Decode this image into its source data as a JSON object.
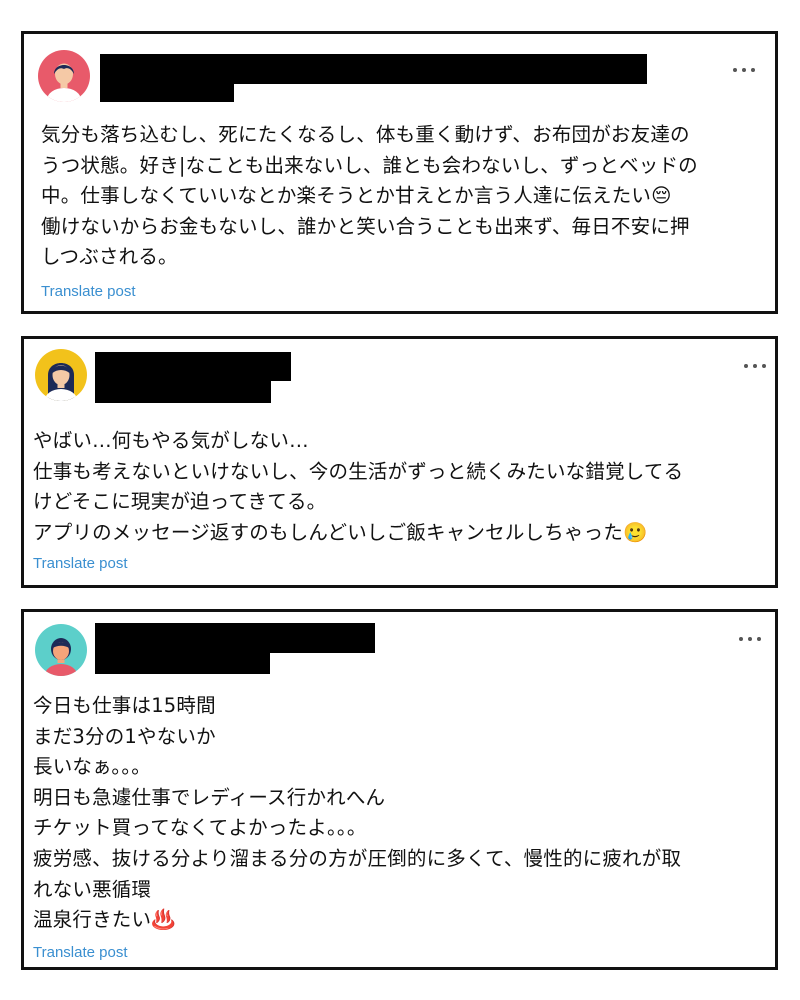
{
  "posts": [
    {
      "avatar": {
        "icon": "avatar-person-icon",
        "bg": "#e85a6a"
      },
      "menu_icon": "more-horizontal-icon",
      "text": "気分も落ち込むし、死にたくなるし、体も重く動けず、お布団がお友達の\nうつ状態。好き|なことも出来ないし、誰とも会わないし、ずっとベッドの\n中。仕事しなくていいなとか楽そうとか甘えとか言う人達に伝えたい😔\n働けないからお金もないし、誰かと笑い合うことも出来ず、毎日不安に押\nしつぶされる。",
      "translate_label": "Translate post"
    },
    {
      "avatar": {
        "icon": "avatar-person-icon",
        "bg": "#f2c21b"
      },
      "menu_icon": "more-horizontal-icon",
      "text": "やばい…何もやる気がしない…\n仕事も考えないといけないし、今の生活がずっと続くみたいな錯覚してる\nけどそこに現実が迫ってきてる。\nアプリのメッセージ返すのもしんどいしご飯キャンセルしちゃった🥲",
      "translate_label": "Translate post"
    },
    {
      "avatar": {
        "icon": "avatar-person-icon",
        "bg": "#5ccfca"
      },
      "menu_icon": "more-horizontal-icon",
      "text": "今日も仕事は15時間\nまだ3分の1やないか\n長いなぁ。。。\n明日も急遽仕事でレディース行かれへん\nチケット買ってなくてよかったよ。。。\n疲労感、抜ける分より溜まる分の方が圧倒的に多くて、慢性的に疲れが取\nれない悪循環\n温泉行きたい♨️",
      "translate_label": "Translate post"
    }
  ]
}
